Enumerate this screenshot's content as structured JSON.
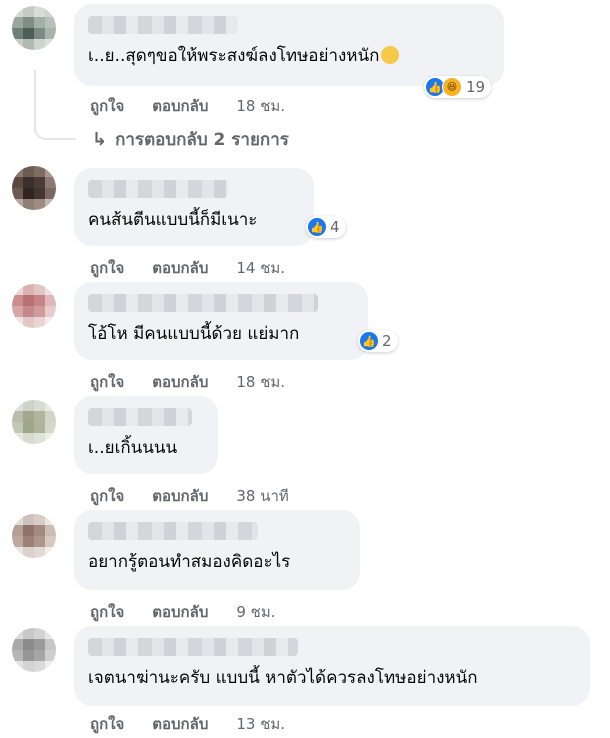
{
  "comments": [
    {
      "text": "เ..ย..สุดๆขอให้พระสงฆ์ลงโทษอย่างหนัก",
      "reaction_count": "19",
      "reaction_types": [
        "like-icon",
        "haha-icon"
      ],
      "like_label": "ถูกใจ",
      "reply_label": "ตอบกลับ",
      "time": "18 ชม."
    },
    {
      "text": "คนส้นตีนแบบนี้ก็มีเนาะ",
      "reaction_count": "4",
      "reaction_types": [
        "like-icon"
      ],
      "like_label": "ถูกใจ",
      "reply_label": "ตอบกลับ",
      "time": "14 ชม."
    },
    {
      "text": "โอ้โห มีคนแบบนี้ด้วย แย่มาก",
      "reaction_count": "2",
      "reaction_types": [
        "like-icon"
      ],
      "like_label": "ถูกใจ",
      "reply_label": "ตอบกลับ",
      "time": "18 ชม."
    },
    {
      "text": "เ..ยเกิ้นนนน",
      "like_label": "ถูกใจ",
      "reply_label": "ตอบกลับ",
      "time": "38 นาที"
    },
    {
      "text": "อยากรู้ตอนทำสมองคิดอะไร",
      "like_label": "ถูกใจ",
      "reply_label": "ตอบกลับ",
      "time": "9 ชม."
    },
    {
      "text": "เจตนาฆ่านะครับ แบบนี้ หาตัวได้ควรลงโทษอย่างหนัก",
      "like_label": "ถูกใจ",
      "reply_label": "ตอบกลับ",
      "time": "13 ชม."
    }
  ],
  "replies_link": "การตอบกลับ 2 รายการ",
  "colors": {
    "bubble_bg": "#f0f2f5",
    "meta_text": "#65676b",
    "like_blue": "#1877f2",
    "haha_yellow": "#f7b125"
  }
}
